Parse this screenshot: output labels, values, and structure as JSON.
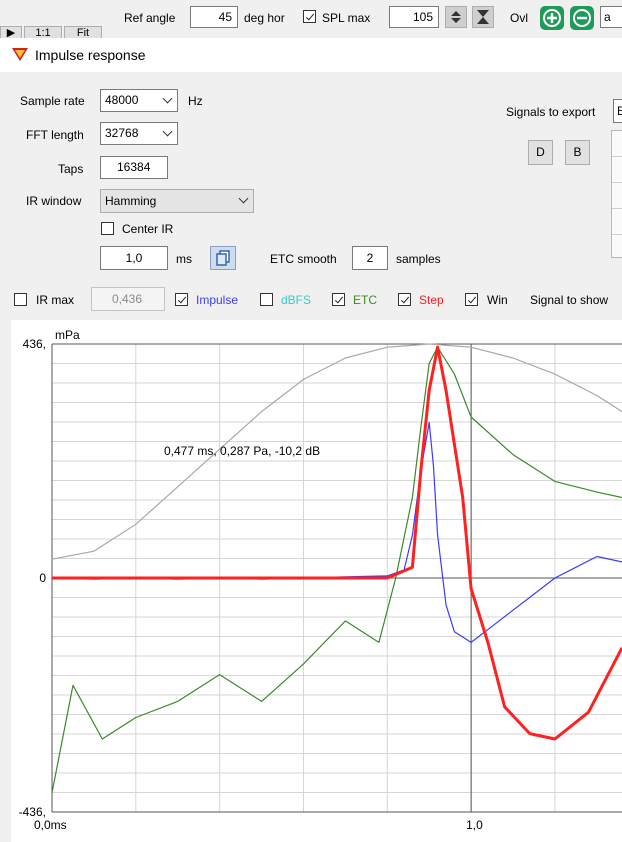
{
  "toolbar": {
    "btn_a": "▶",
    "btn_b": "1:1",
    "btn_c": "Fit",
    "ref_angle_label": "Ref angle",
    "ref_angle_value": "45",
    "deg_hor_label": "deg hor",
    "spl_max_label": "SPL max",
    "spl_max_checked": true,
    "spl_max_value": "105",
    "ovl_label": "Ovl",
    "edge_label": "a"
  },
  "window": {
    "title": "Impulse response"
  },
  "settings": {
    "sample_rate_label": "Sample rate",
    "sample_rate_value": "48000",
    "hz_label": "Hz",
    "fft_length_label": "FFT length",
    "fft_length_value": "32768",
    "taps_label": "Taps",
    "taps_value": "16384",
    "ir_window_label": "IR window",
    "ir_window_value": "Hamming",
    "center_ir_label": "Center IR",
    "center_ir_checked": false,
    "ms_value": "1,0",
    "ms_label": "ms",
    "etc_smooth_label": "ETC smooth",
    "etc_smooth_value": "2",
    "samples_label": "samples",
    "signals_export_label": "Signals to export",
    "export_d": "D",
    "export_b": "B",
    "export_edge": "E"
  },
  "signals": {
    "ir_max_label": "IR max",
    "ir_max_checked": false,
    "ir_max_value": "0,436",
    "impulse_label": "Impulse",
    "impulse_checked": true,
    "dbfs_label": "dBFS",
    "dbfs_checked": false,
    "etc_label": "ETC",
    "etc_checked": true,
    "step_label": "Step",
    "step_checked": true,
    "win_label": "Win",
    "win_checked": true,
    "signal_to_show_label": "Signal to show"
  },
  "colors": {
    "impulse": "#3b3bff",
    "dbfs": "#33cccc",
    "etc": "#3a8a2a",
    "step": "#ff2020",
    "win": "#a8a8a8",
    "grid": "#d6d6d6",
    "axis": "#555555",
    "ovl_buttons": "#1f9a58"
  },
  "chart_data": {
    "type": "line",
    "ylabel": "mPa",
    "ylim": [
      -436,
      436
    ],
    "xlim": [
      0,
      1.36
    ],
    "y_tick_labels": [
      "436,",
      "0",
      "-436,"
    ],
    "x_tick_labels": [
      "0,0ms",
      "1,0"
    ],
    "cursor_readout": "0,477 ms, 0,287 Pa, -10,2 dB",
    "series": [
      {
        "name": "Impulse",
        "color": "#3b3bff",
        "x": [
          0,
          0.1,
          0.2,
          0.3,
          0.4,
          0.5,
          0.6,
          0.7,
          0.8,
          0.84,
          0.86,
          0.88,
          0.9,
          0.91,
          0.92,
          0.94,
          0.96,
          1.0,
          1.05,
          1.1,
          1.15,
          1.2,
          1.25,
          1.3,
          1.36
        ],
        "y": [
          0,
          -2,
          0,
          -2,
          0,
          -2,
          0,
          2,
          4,
          15,
          80,
          200,
          290,
          210,
          80,
          -50,
          -100,
          -120,
          -90,
          -60,
          -30,
          0,
          20,
          40,
          30
        ]
      },
      {
        "name": "ETC",
        "color": "#3a8a2a",
        "x": [
          0,
          0.05,
          0.12,
          0.2,
          0.3,
          0.4,
          0.5,
          0.6,
          0.7,
          0.78,
          0.82,
          0.86,
          0.88,
          0.9,
          0.92,
          0.96,
          1.0,
          1.1,
          1.2,
          1.3,
          1.36
        ],
        "y": [
          -400,
          -200,
          -300,
          -260,
          -230,
          -180,
          -230,
          -160,
          -80,
          -120,
          0,
          150,
          280,
          400,
          430,
          380,
          300,
          230,
          180,
          160,
          150
        ]
      },
      {
        "name": "Step",
        "color": "#ff2020",
        "x": [
          0,
          0.2,
          0.4,
          0.6,
          0.8,
          0.86,
          0.88,
          0.9,
          0.92,
          0.94,
          0.98,
          1.0,
          1.04,
          1.08,
          1.14,
          1.2,
          1.28,
          1.36
        ],
        "y": [
          0,
          0,
          0,
          0,
          0,
          20,
          200,
          350,
          430,
          350,
          150,
          -20,
          -120,
          -240,
          -290,
          -300,
          -250,
          -130
        ]
      },
      {
        "name": "Win",
        "color": "#a8a8a8",
        "x": [
          0,
          0.1,
          0.2,
          0.3,
          0.4,
          0.5,
          0.6,
          0.7,
          0.8,
          0.9,
          1.0,
          1.1,
          1.2,
          1.3,
          1.36
        ],
        "y": [
          35,
          50,
          100,
          170,
          240,
          310,
          370,
          410,
          430,
          436,
          430,
          410,
          380,
          340,
          310
        ]
      }
    ]
  }
}
